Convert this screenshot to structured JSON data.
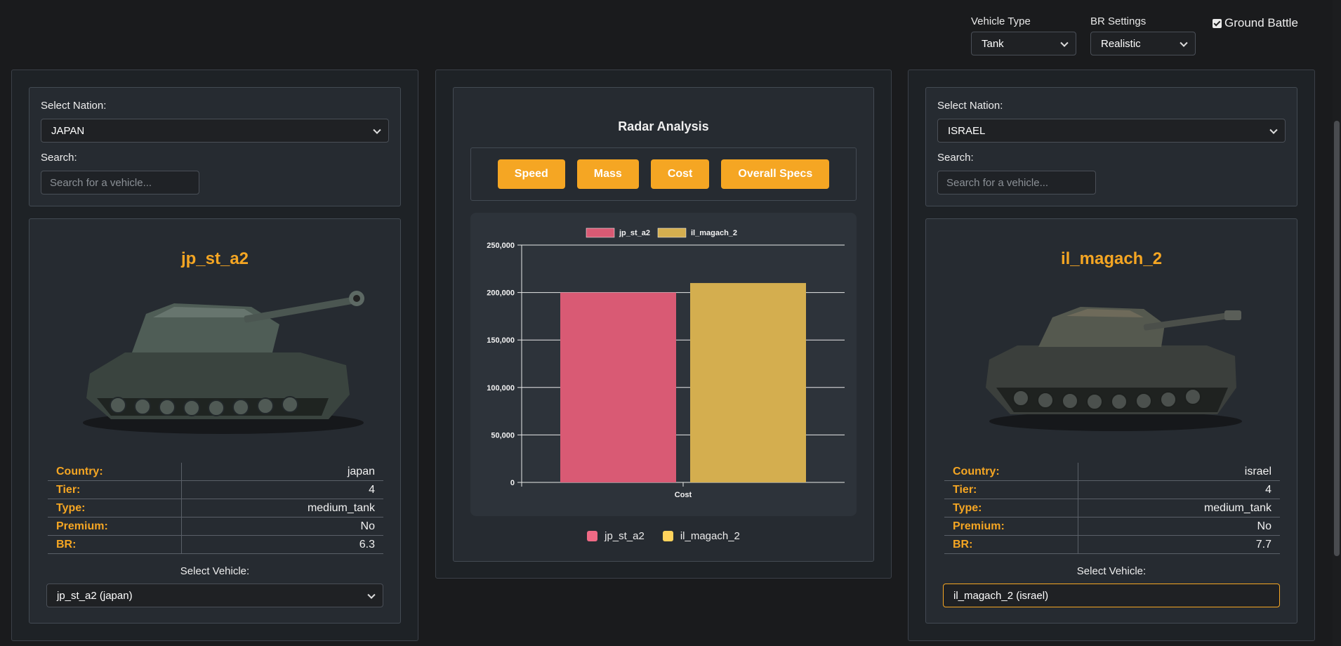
{
  "topbar": {
    "vehicle_type_label": "Vehicle Type",
    "vehicle_type_value": "Tank",
    "br_settings_label": "BR Settings",
    "br_settings_value": "Realistic",
    "ground_battle_label": "Ground Battle",
    "ground_battle_checked": true
  },
  "left": {
    "nation_label": "Select Nation:",
    "nation_value": "JAPAN",
    "search_label": "Search:",
    "search_placeholder": "Search for a vehicle...",
    "vehicle_name": "jp_st_a2",
    "stats": [
      {
        "key": "Country:",
        "value": "japan"
      },
      {
        "key": "Tier:",
        "value": "4"
      },
      {
        "key": "Type:",
        "value": "medium_tank"
      },
      {
        "key": "Premium:",
        "value": "No"
      },
      {
        "key": "BR:",
        "value": "6.3"
      }
    ],
    "select_vehicle_label": "Select Vehicle:",
    "select_vehicle_value": "jp_st_a2 (japan)"
  },
  "right": {
    "nation_label": "Select Nation:",
    "nation_value": "ISRAEL",
    "search_label": "Search:",
    "search_placeholder": "Search for a vehicle...",
    "vehicle_name": "il_magach_2",
    "stats": [
      {
        "key": "Country:",
        "value": "israel"
      },
      {
        "key": "Tier:",
        "value": "4"
      },
      {
        "key": "Type:",
        "value": "medium_tank"
      },
      {
        "key": "Premium:",
        "value": "No"
      },
      {
        "key": "BR:",
        "value": "7.7"
      }
    ],
    "select_vehicle_label": "Select Vehicle:",
    "select_vehicle_value": "il_magach_2 (israel)"
  },
  "middle": {
    "title": "Radar Analysis",
    "buttons": [
      "Speed",
      "Mass",
      "Cost",
      "Overall Specs"
    ],
    "legend": [
      {
        "name": "jp_st_a2",
        "color": "#f06a85"
      },
      {
        "name": "il_magach_2",
        "color": "#ffd35c"
      }
    ]
  },
  "chart_data": {
    "type": "bar",
    "categories": [
      "Cost"
    ],
    "series": [
      {
        "name": "jp_st_a2",
        "values": [
          200000
        ],
        "color": "#d95a74"
      },
      {
        "name": "il_magach_2",
        "values": [
          210000
        ],
        "color": "#d4ae4f"
      }
    ],
    "ylim": [
      0,
      250000
    ],
    "yticks": [
      0,
      50000,
      100000,
      150000,
      200000,
      250000
    ],
    "ytick_labels": [
      "0",
      "50,000",
      "100,000",
      "150,000",
      "200,000",
      "250,000"
    ],
    "grid": true,
    "legend_position": "top"
  },
  "colors": {
    "accent": "#f5a623",
    "background": "#1a1b1d",
    "panel": "#262b31"
  }
}
